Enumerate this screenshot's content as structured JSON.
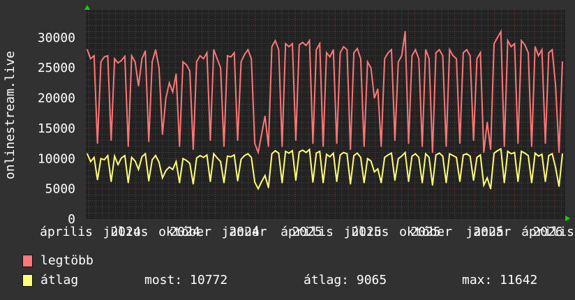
{
  "chart_data": {
    "type": "line",
    "ylabel": "onlinestream.live",
    "ylim": [
      0,
      34600
    ],
    "yticks": [
      "0",
      "5000",
      "10000",
      "15000",
      "20000",
      "25000",
      "30000"
    ],
    "x_range": [
      "2024-04",
      "2026-04"
    ],
    "xtick_months": [
      "április",
      "július",
      "október",
      "január",
      "április",
      "július",
      "október",
      "január",
      "április"
    ],
    "xtick_years": [
      "2024",
      "2024",
      "2024",
      "2025",
      "2025",
      "2025",
      "2025",
      "2026"
    ],
    "grid": true,
    "legend_placement": "bottom-left",
    "series": [
      {
        "name": "legtöbb",
        "color": "#ff7777",
        "values": [
          28000,
          26500,
          27000,
          12500,
          26000,
          26800,
          27000,
          13000,
          26500,
          25800,
          26200,
          26900,
          12000,
          27000,
          26000,
          22000,
          26500,
          27800,
          12800,
          26000,
          28000,
          25000,
          14000,
          20000,
          22500,
          21000,
          24000,
          12000,
          26000,
          25500,
          24500,
          11500,
          26000,
          27000,
          26500,
          27500,
          13000,
          28000,
          26500,
          25000,
          12000,
          27000,
          26800,
          27500,
          13000,
          26000,
          27200,
          28000,
          26500,
          12500,
          11000,
          14000,
          17000,
          12000,
          28500,
          29500,
          28000,
          12000,
          29000,
          28500,
          29000,
          13000,
          28800,
          29200,
          28700,
          29500,
          12500,
          28000,
          29000,
          12000,
          27500,
          26800,
          28000,
          12500,
          27500,
          28500,
          28000,
          11500,
          27500,
          28200,
          26500,
          12000,
          26000,
          25000,
          20000,
          21500,
          12000,
          26500,
          27500,
          28000,
          13000,
          26000,
          27000,
          31000,
          12500,
          27000,
          28000,
          26500,
          12000,
          28000,
          26500,
          11000,
          27500,
          28000,
          27000,
          12000,
          28000,
          27000,
          26500,
          12500,
          27500,
          28000,
          27000,
          13000,
          26500,
          27500,
          11000,
          16000,
          11500,
          29000,
          30000,
          31000,
          12000,
          29500,
          28500,
          29000,
          12500,
          29500,
          28800,
          27500,
          12000,
          28500,
          27000,
          28000,
          12500,
          27500,
          28000,
          22000,
          11000,
          26000
        ]
      },
      {
        "name": "átlag",
        "color": "#ffff77",
        "values": [
          10800,
          9500,
          10200,
          6500,
          10000,
          9800,
          10500,
          6200,
          10400,
          9000,
          10100,
          10500,
          6000,
          10200,
          9600,
          8200,
          10300,
          10800,
          6300,
          9800,
          10500,
          9400,
          6800,
          8000,
          8600,
          8200,
          9500,
          6000,
          10000,
          9700,
          9200,
          5800,
          10100,
          10500,
          10200,
          10600,
          6200,
          10800,
          10100,
          9500,
          6000,
          10400,
          10300,
          10600,
          6300,
          9900,
          10500,
          10800,
          10200,
          6100,
          5000,
          6200,
          7200,
          5200,
          10800,
          11300,
          10900,
          6000,
          11200,
          10900,
          11300,
          6400,
          11100,
          11400,
          11000,
          11500,
          6100,
          10900,
          11200,
          6000,
          10700,
          10300,
          10900,
          6200,
          10600,
          11000,
          10800,
          5800,
          10500,
          10900,
          10200,
          6000,
          10000,
          9600,
          7800,
          8300,
          6000,
          10200,
          10600,
          10900,
          6400,
          10000,
          10400,
          11000,
          6200,
          10400,
          10800,
          10200,
          6000,
          10800,
          10200,
          5600,
          10600,
          10900,
          10400,
          6000,
          10800,
          10500,
          10200,
          6200,
          10600,
          10800,
          10400,
          6400,
          10200,
          10600,
          5600,
          6800,
          5000,
          10900,
          11300,
          11600,
          6000,
          11200,
          10800,
          11000,
          6200,
          11200,
          10900,
          10500,
          6000,
          10900,
          10400,
          10700,
          6200,
          10500,
          10800,
          8500,
          5400,
          10772
        ]
      }
    ]
  },
  "legend": {
    "items": [
      {
        "label": "legtöbb",
        "color": "#ff7777"
      },
      {
        "label": "átlag",
        "color": "#ffff77"
      }
    ],
    "stats": {
      "most": "most: 10772",
      "atlag": "átlag: 9065",
      "max": "max: 11642"
    }
  }
}
